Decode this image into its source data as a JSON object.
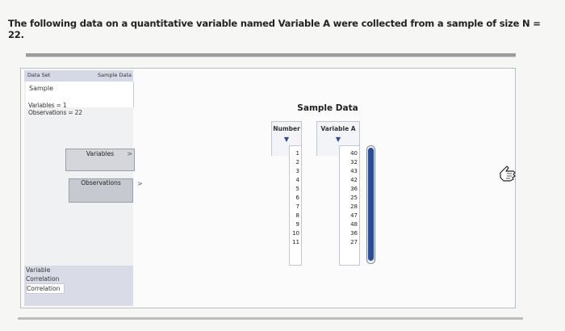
{
  "question": "The following data on a quantitative variable named Variable A were collected from a sample of size N = 22.",
  "sidebar": {
    "tab_left": "Data Set",
    "tab_right": "Sample Data",
    "dataset_name": "Sample",
    "variables_count": "Variables = 1",
    "observations_count": "Observations = 22",
    "variables_button": "Variables",
    "observations_button": "Observations",
    "variables_chevron": ">",
    "observations_chevron": ">",
    "list": [
      "Variable",
      "Correlation",
      "Correlation"
    ]
  },
  "table": {
    "title": "Sample Data",
    "number_header": "Number",
    "variable_header": "Variable A",
    "sort_glyph": "▼",
    "numbers": [
      "1",
      "2",
      "3",
      "4",
      "5",
      "6",
      "7",
      "8",
      "9",
      "10",
      "11"
    ],
    "values": [
      "40",
      "32",
      "43",
      "42",
      "36",
      "25",
      "28",
      "47",
      "48",
      "36",
      "27"
    ]
  },
  "colors": {
    "accent": "#2d4b9b",
    "panel_border": "#b8bcc4",
    "sidebar_tab": "#d5d9e6"
  }
}
